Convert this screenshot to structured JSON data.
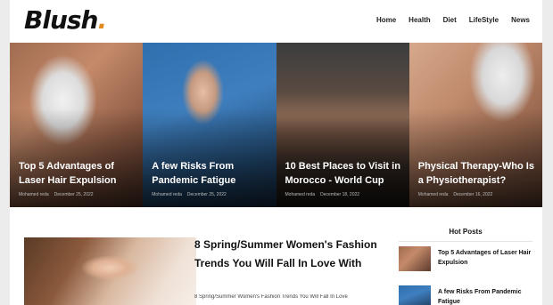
{
  "brand": {
    "name": "Blush",
    "dot": ".",
    "accent": "#e38b1e"
  },
  "nav": [
    "Home",
    "Health",
    "Diet",
    "LifeStyle",
    "News"
  ],
  "hero": [
    {
      "title": "Top 5 Advantages of Laser Hair Expulsion",
      "author": "Mohamed reda",
      "date": "December 25, 2022",
      "image": "woman-laser-treatment"
    },
    {
      "title": "A few Risks From Pandemic Fatigue",
      "author": "Mohamed reda",
      "date": "December 25, 2022",
      "image": "man-blue-hoodie"
    },
    {
      "title": "10 Best Places to Visit in Morocco - World Cup",
      "author": "Mohamed reda",
      "date": "December 18, 2022",
      "image": "morocco-desert"
    },
    {
      "title": "Physical Therapy-Who Is a Physiotherapist?",
      "author": "Mohamed reda",
      "date": "December 16, 2022",
      "image": "physiotherapy-massage"
    }
  ],
  "feature": {
    "title": "8 Spring/Summer Women's Fashion Trends You Will Fall In Love With",
    "excerpt": "8 Spring/Summer Women's Fashion Trends You Will Fall In Love",
    "image": "woman-portrait"
  },
  "hot_posts": {
    "heading": "Hot Posts",
    "items": [
      {
        "title": "Top 5 Advantages of Laser Hair Expulsion"
      },
      {
        "title": "A few Risks From Pandemic Fatigue"
      }
    ]
  },
  "icons": {
    "author": "user-icon",
    "date": "clock-icon"
  }
}
